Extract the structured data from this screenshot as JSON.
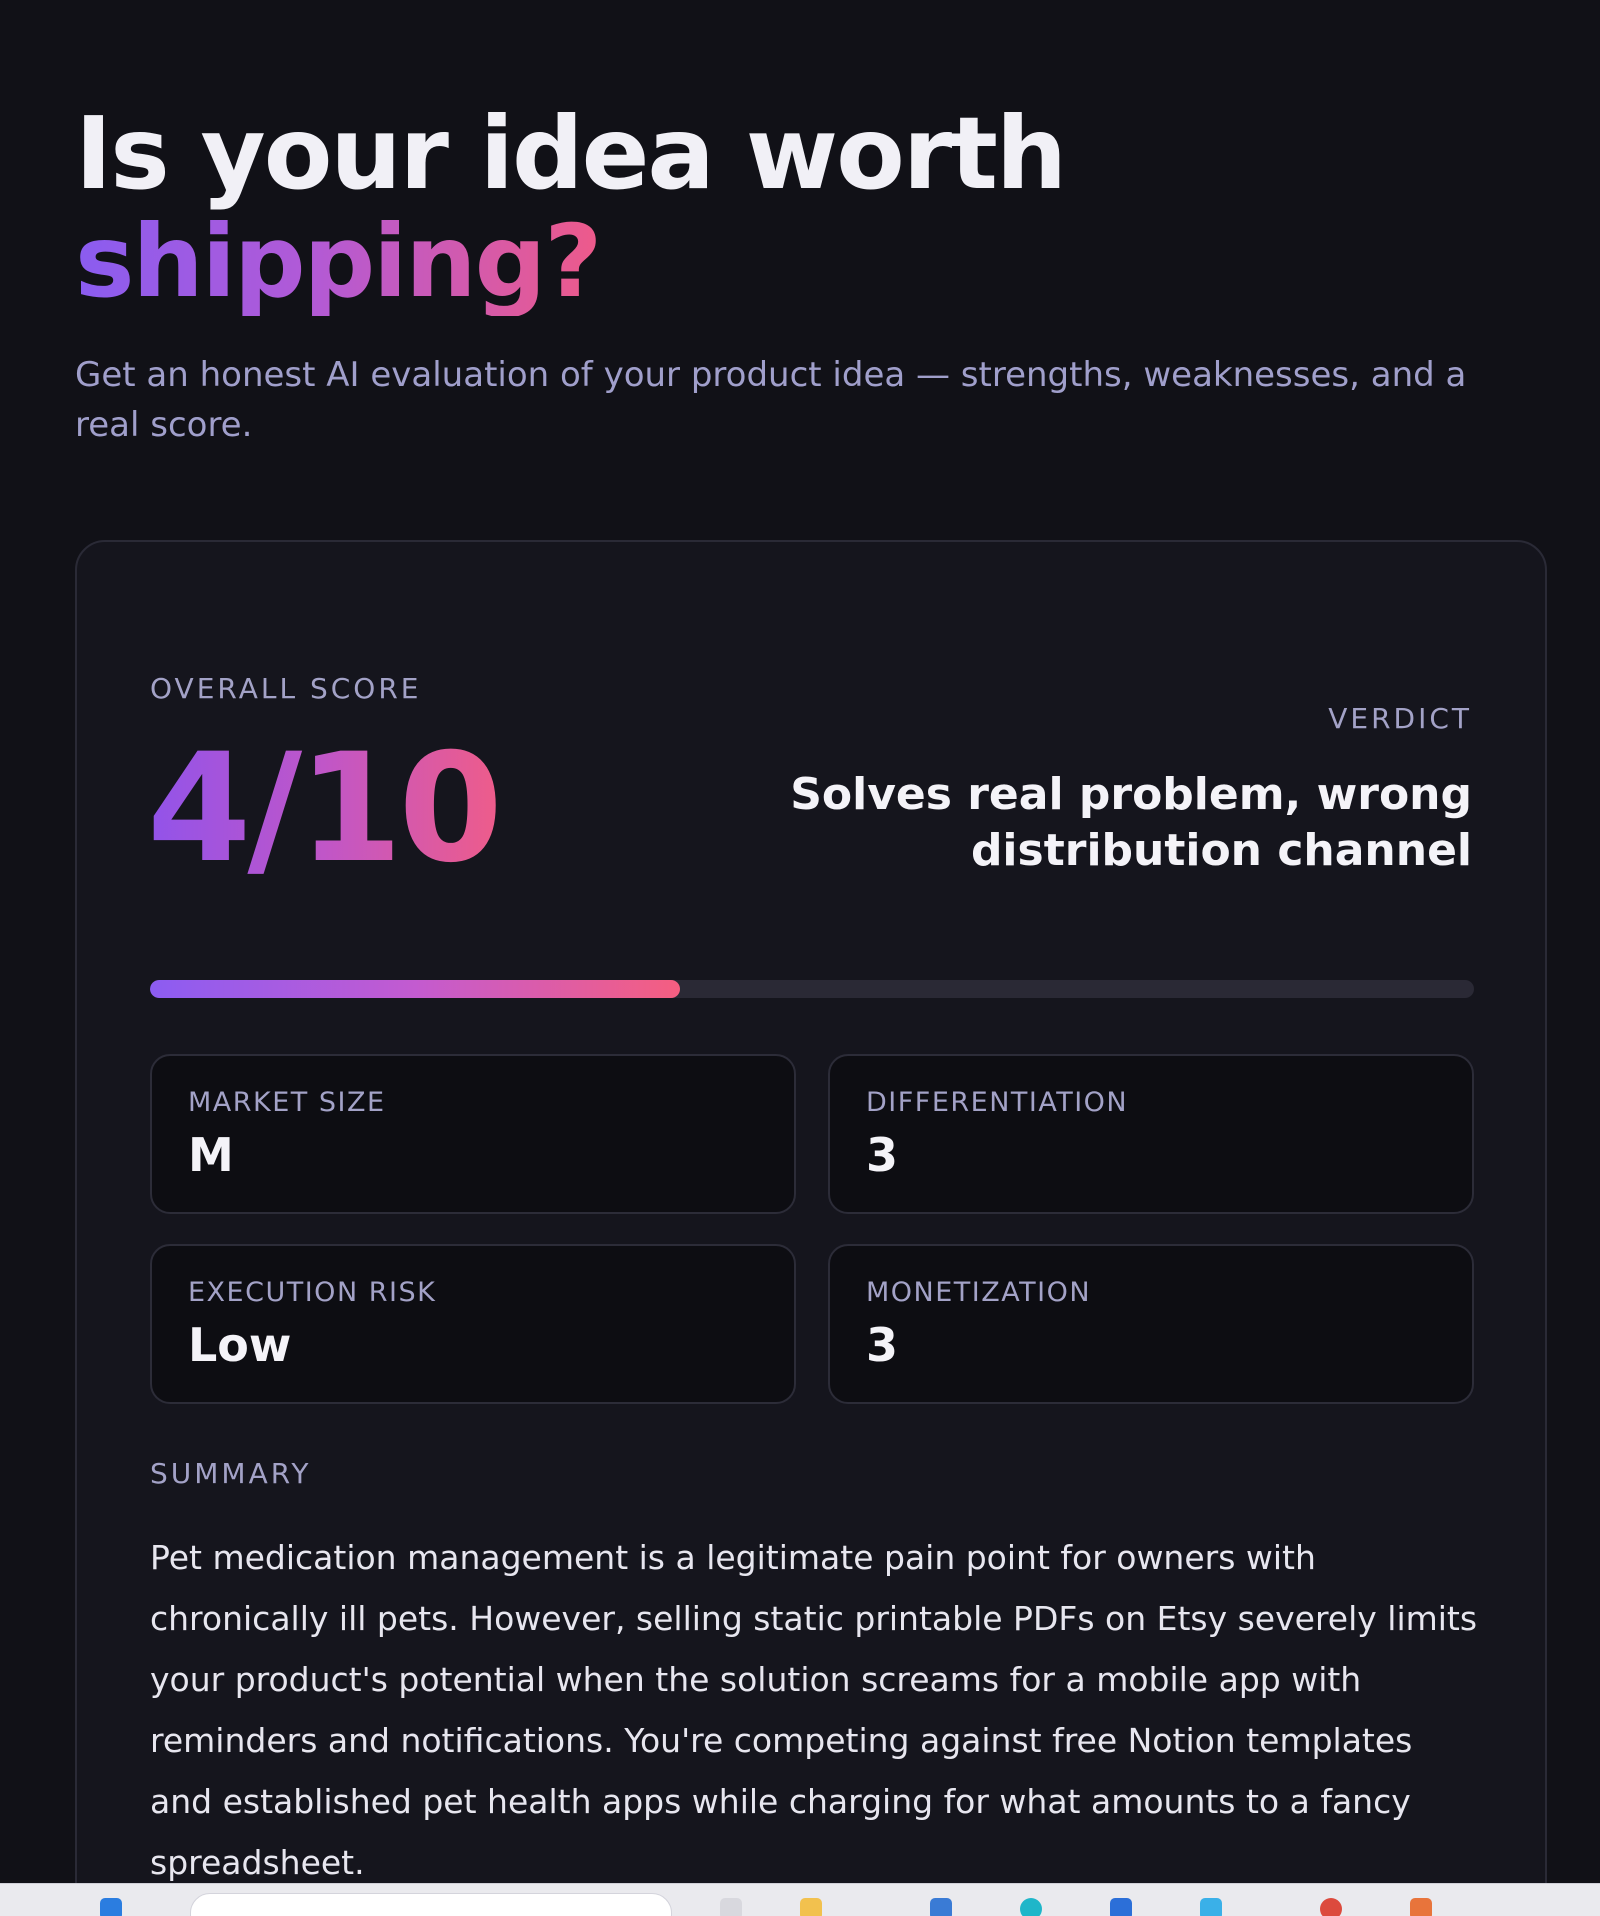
{
  "hero": {
    "title_line1": "Is your idea worth",
    "title_accent": "shipping?",
    "subtitle": "Get an honest AI evaluation of your product idea — strengths, weaknesses, and a real score."
  },
  "result": {
    "score_label": "OVERALL SCORE",
    "score": "4/10",
    "score_fraction": 0.4,
    "verdict_label": "VERDICT",
    "verdict": "Solves real problem, wrong distribution channel",
    "stats": [
      {
        "label": "MARKET SIZE",
        "value": "M"
      },
      {
        "label": "DIFFERENTIATION",
        "value": "3"
      },
      {
        "label": "EXECUTION RISK",
        "value": "Low"
      },
      {
        "label": "MONETIZATION",
        "value": "3"
      }
    ],
    "summary_label": "SUMMARY",
    "summary": "Pet medication management is a legitimate pain point for owners with chronically ill pets. However, selling static printable PDFs on Etsy severely limits your product's potential when the solution screams for a mobile app with reminders and notifications. You're competing against free Notion templates and established pet health apps while charging for what amounts to a fancy spreadsheet."
  },
  "colors": {
    "background": "#111117",
    "card": "#15151d",
    "accent_start": "#8c5cf2",
    "accent_end": "#f55e80"
  },
  "taskbar": {
    "icons": [
      "windows-icon",
      "search-box",
      "file-icon",
      "folder-icon",
      "mail-icon",
      "edge-icon",
      "store-icon",
      "app-icon",
      "chrome-icon",
      "app-icon"
    ]
  }
}
